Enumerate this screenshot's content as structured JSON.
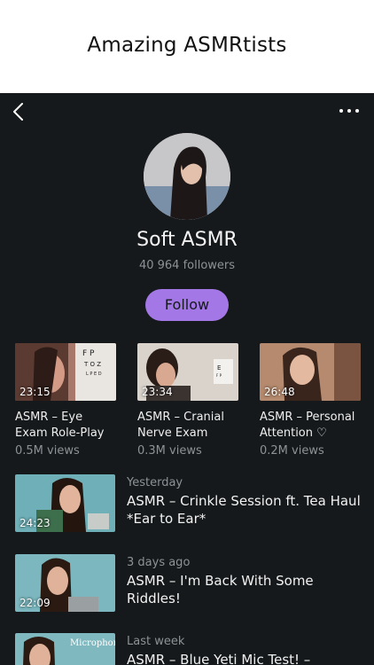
{
  "banner": {
    "title": "Amazing ASMRtists"
  },
  "channel": {
    "name": "Soft ASMR",
    "followers": "40 964 followers",
    "follow_label": "Follow"
  },
  "grid_videos": [
    {
      "title": "ASMR – Eye Exam Role-Play",
      "duration": "23:15",
      "views": "0.5M views"
    },
    {
      "title": "ASMR – Cranial Nerve Exam",
      "duration": "23:34",
      "views": "0.3M views"
    },
    {
      "title": "ASMR – Personal Attention ♡",
      "duration": "26:48",
      "views": "0.2M views"
    }
  ],
  "list_videos": [
    {
      "date": "Yesterday",
      "title": "ASMR – Crinkle Session ft. Tea Haul *Ear to Ear*",
      "duration": "24:23"
    },
    {
      "date": "3 days ago",
      "title": "ASMR – I'm Back With Some Riddles!",
      "duration": "22:09"
    },
    {
      "date": "Last week",
      "title": "ASMR – Blue Yeti Mic Test! –",
      "thumb_text": "Microphone Test"
    }
  ],
  "colors": {
    "background": "#15191b",
    "accent": "#a377e6",
    "muted": "#8d9296"
  },
  "icons": {
    "back": "chevron-left-icon",
    "more": "more-horizontal-icon"
  }
}
